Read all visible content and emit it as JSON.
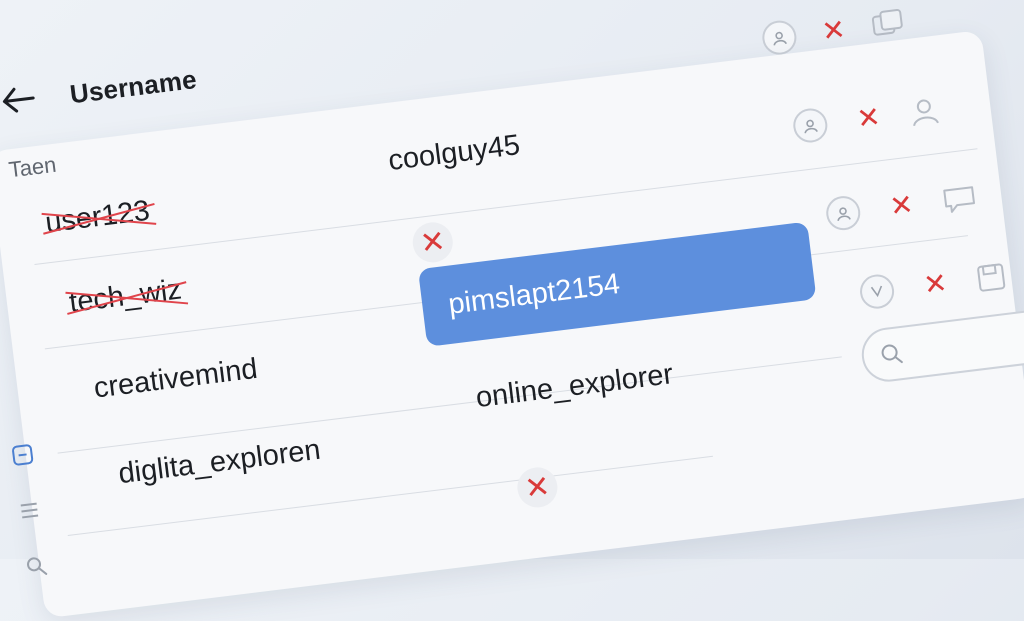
{
  "header": {
    "title": "Username"
  },
  "section": {
    "label": "Taen"
  },
  "rows": [
    {
      "left": "user123",
      "left_struck": true,
      "right": "coolguy45"
    },
    {
      "left": "tech_wiz",
      "left_struck": true,
      "right": ""
    },
    {
      "left": "creativemind",
      "left_struck": false,
      "right": "pimslapt2154"
    },
    {
      "left": "diglita_exploren",
      "left_struck": false,
      "right": "online_explorer"
    }
  ],
  "selected_value": "pimslapt2154",
  "colors": {
    "accent": "#5d8fdd",
    "danger": "#d93a3a",
    "background": "#eef2f7"
  }
}
